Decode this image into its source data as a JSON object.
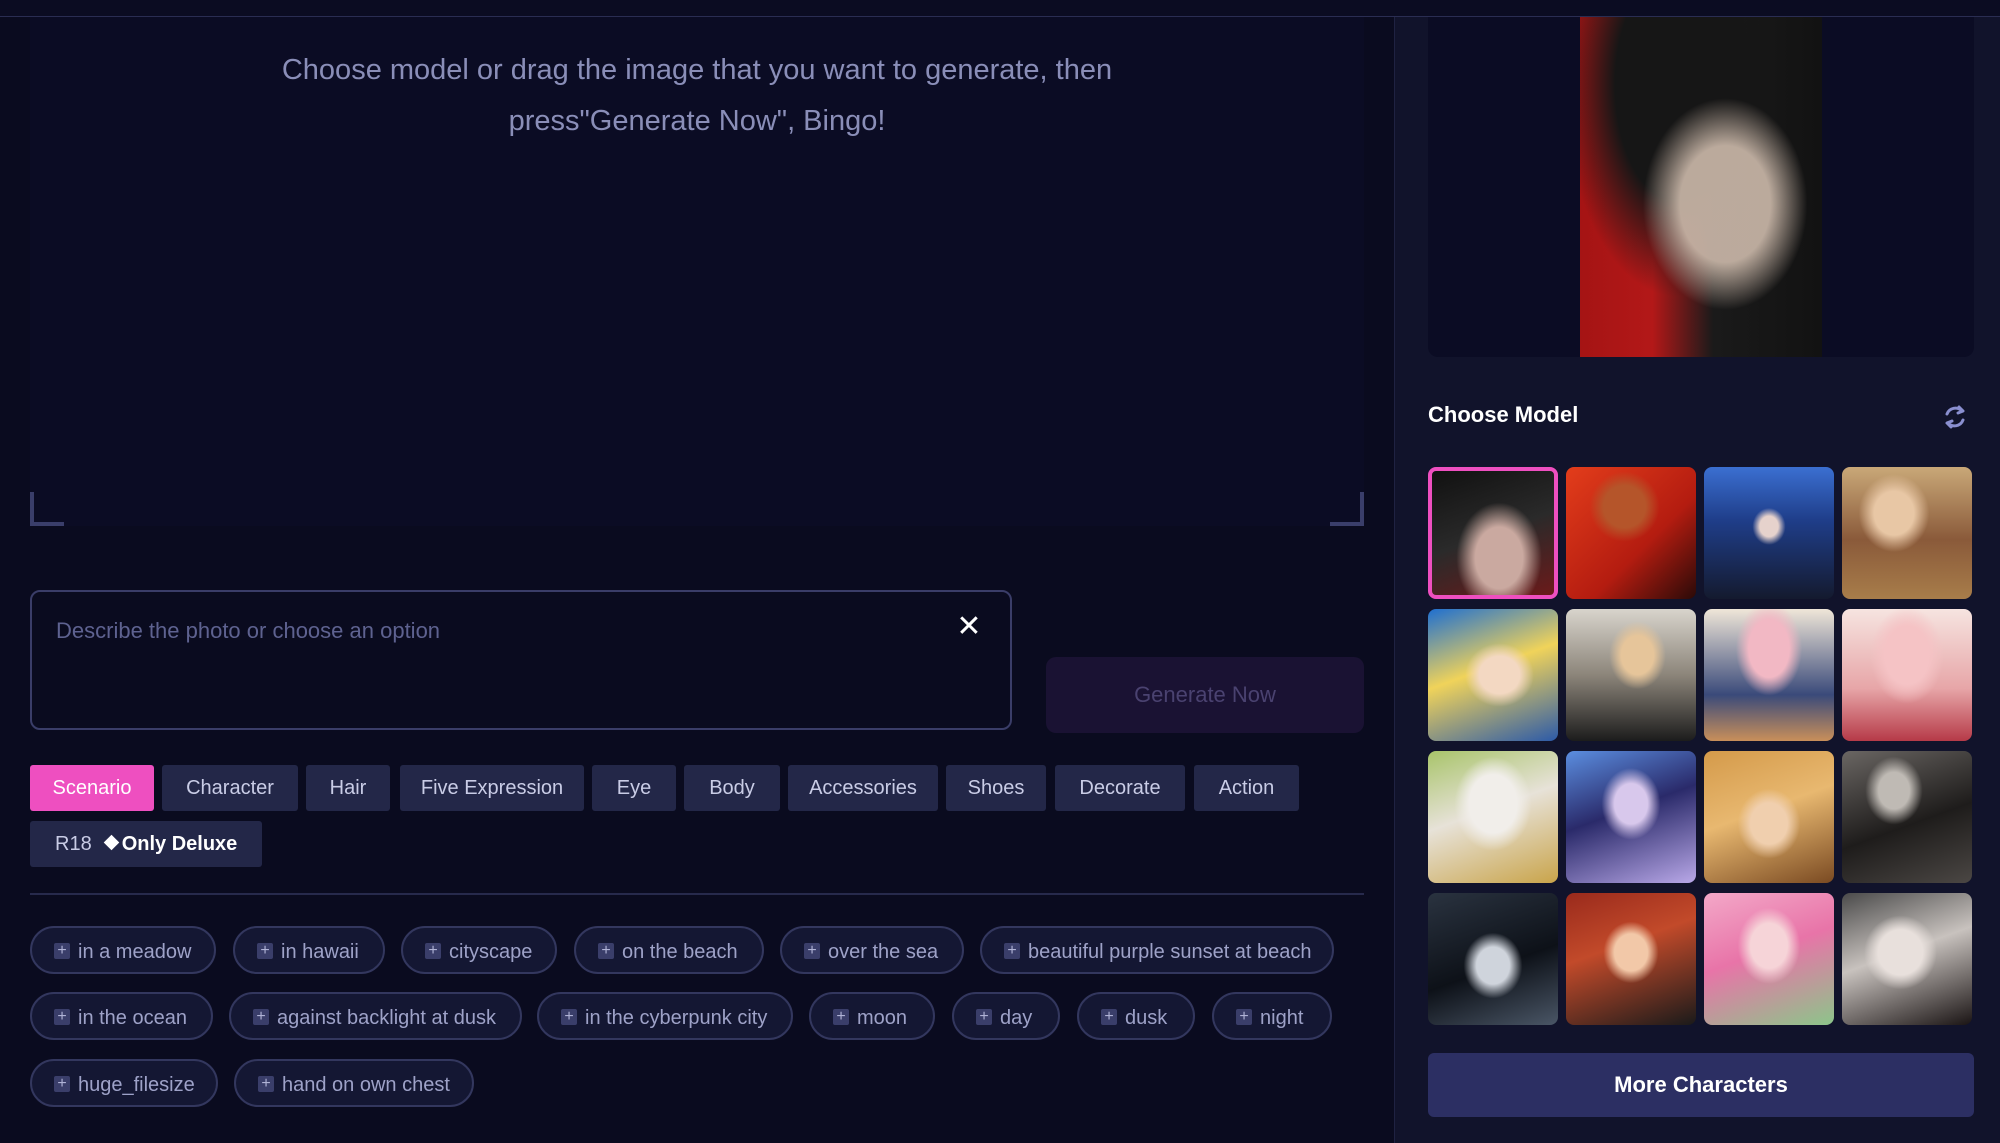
{
  "dropzone": {
    "line1": "Choose model or drag the image that you want to generate, then",
    "line2": "press\"Generate Now\", Bingo!"
  },
  "prompt": {
    "placeholder": "Describe the photo or choose an option"
  },
  "generate_button": "Generate Now",
  "categories": [
    {
      "label": "Scenario",
      "active": true
    },
    {
      "label": "Character"
    },
    {
      "label": "Hair"
    },
    {
      "label": "Five Expression"
    },
    {
      "label": "Eye"
    },
    {
      "label": "Body"
    },
    {
      "label": "Accessories"
    },
    {
      "label": "Shoes"
    },
    {
      "label": "Decorate"
    },
    {
      "label": "Action"
    }
  ],
  "r18": {
    "label": "R18",
    "deluxe": "Only Deluxe"
  },
  "tags": [
    "in a meadow",
    "in hawaii",
    "cityscape",
    "on the beach",
    "over the sea",
    "beautiful purple sunset at beach",
    "in the ocean",
    "against backlight at dusk",
    "in the cyberpunk city",
    "moon",
    "day",
    "dusk",
    "night",
    "huge_filesize",
    "hand on own chest"
  ],
  "sidebar": {
    "choose_title": "Choose Model",
    "more_button": "More Characters",
    "models": [
      {
        "name": "dark-hair-boy",
        "selected": true
      },
      {
        "name": "red-suit-hero"
      },
      {
        "name": "black-hair-girl-blue-city"
      },
      {
        "name": "blonde-farm-girl"
      },
      {
        "name": "blonde-android-girl"
      },
      {
        "name": "blonde-boy-black-shirt"
      },
      {
        "name": "pink-hair-schoolgirl"
      },
      {
        "name": "pink-hair-girl-red-top"
      },
      {
        "name": "white-hair-elf-girl"
      },
      {
        "name": "purple-hair-kimono-girl"
      },
      {
        "name": "fox-ear-blonde-girl"
      },
      {
        "name": "dark-hair-man-bw"
      },
      {
        "name": "dark-hair-boy-portrait"
      },
      {
        "name": "red-hair-woman-suit"
      },
      {
        "name": "pink-green-braids-girl"
      },
      {
        "name": "white-hair-grinning-girl"
      }
    ]
  },
  "colors": {
    "accent": "#ee4fc0",
    "bg": "#0a0b1f",
    "panel": "#11132b",
    "more_button": "#2c2f63"
  }
}
